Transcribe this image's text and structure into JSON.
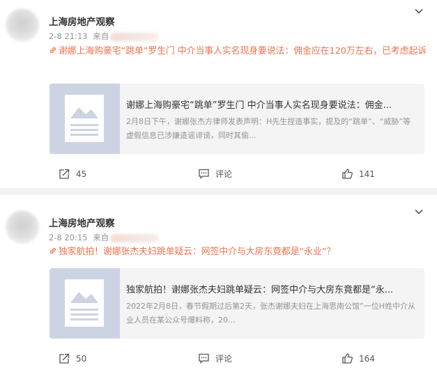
{
  "posts": [
    {
      "author": "上海房地产观察",
      "time": "2-8 21:13",
      "source_prefix": "来自",
      "content": "谢娜上海购豪宅“跳单”罗生门 中介当事人实名现身要说法：佣金应在120万左右，已考虑起诉",
      "card_title": "谢娜上海购豪宅“跳单”罗生门 中介当事人实名现身要说法：佣金...",
      "card_desc": "2月8日下午，谢娜张杰方律师发表声明：H先生捏造事实，提及的“跳单”、“威胁”等虚假信息已涉嫌造谣诽谤，同时其偷...",
      "repost_count": "45",
      "comment_label": "评论",
      "like_count": "141"
    },
    {
      "author": "上海房地产观察",
      "time": "2-8 20:15",
      "source_prefix": "来自",
      "content": "独家航拍！谢娜张杰夫妇跳单疑云：网签中介与大房东竟都是“永业”？",
      "card_title": "独家航拍！谢娜张杰夫妇跳单疑云：网签中介与大房东竟都是“永...",
      "card_desc": "2022年2月8日，春节假期过后第2天，张杰谢娜夫妇在上海思南公馆”一位H姓中介从业人员在某公众号爆料称，20...",
      "repost_count": "50",
      "comment_label": "评论",
      "like_count": "164"
    }
  ],
  "icons": {
    "more": "chevron-down-icon",
    "link": "link-icon",
    "repost": "repost-icon",
    "comment": "comment-icon",
    "like": "like-icon"
  },
  "colors": {
    "link_text": "#eb7350",
    "thumb_bg": "#ccd3e2",
    "card_bg": "#f4f4f4",
    "separator": "#f2f2f2"
  }
}
